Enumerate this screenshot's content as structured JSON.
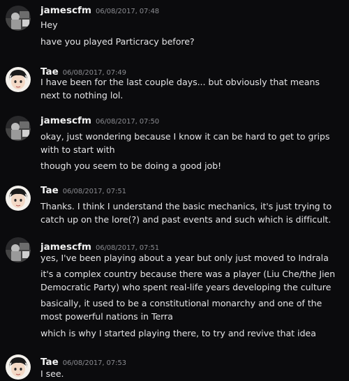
{
  "avatars": {
    "jamescfm": "photo-avatar-icon",
    "tae": "anime-character-avatar-icon"
  },
  "messages": [
    {
      "author": "jamescfm",
      "timestamp": "06/08/2017, 07:48",
      "lines": [
        "Hey",
        "have you played Particracy before?"
      ]
    },
    {
      "author": "Tae",
      "timestamp": "06/08/2017, 07:49",
      "lines": [
        "I have been for the last couple days... but obviously that means next to nothing lol."
      ]
    },
    {
      "author": "jamescfm",
      "timestamp": "06/08/2017, 07:50",
      "lines": [
        "okay, just wondering because I know it can be hard to get to grips with to start with",
        "though you seem to be doing a good job!"
      ]
    },
    {
      "author": "Tae",
      "timestamp": "06/08/2017, 07:51",
      "lines": [
        "Thanks. I think I understand the basic mechanics, it's just trying to catch up on the lore(?) and past events and such which is difficult."
      ]
    },
    {
      "author": "jamescfm",
      "timestamp": "06/08/2017, 07:51",
      "lines": [
        "yes, I've been playing about a year but only just moved to Indrala",
        "it's a complex country because there was a player (Liu Che/the Jien Democratic Party) who spent real-life years developing the culture",
        "basically, it used to be a constitutional monarchy and one of the most powerful nations in Terra",
        "which is why I started playing there, to try and revive that idea"
      ]
    },
    {
      "author": "Tae",
      "timestamp": "06/08/2017, 07:53",
      "lines": [
        "I see."
      ]
    }
  ]
}
